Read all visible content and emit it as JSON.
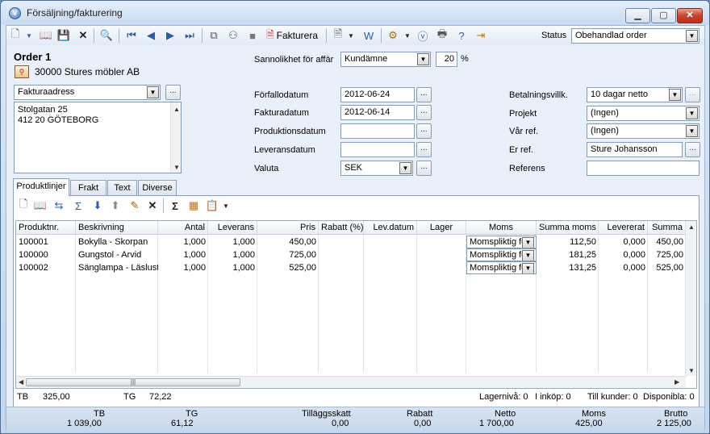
{
  "window": {
    "title": "Försäljning/fakturering",
    "minimize": "▁",
    "maximize": "▢",
    "close": "✕"
  },
  "toolbar": {
    "fakturera": "Fakturera",
    "status_label": "Status",
    "status_value": "Obehandlad order"
  },
  "order": {
    "title": "Order 1",
    "customer": "30000 Stures möbler AB"
  },
  "address": {
    "type": "Fakturaadress",
    "line1": "Stolgatan 25",
    "line2": "412 20 GÖTEBORG",
    "browse": "..."
  },
  "middle": {
    "sannolikhet_label": "Sannolikhet för affär",
    "sannolikhet_value": "Kundämne",
    "percent": "20",
    "percent_sign": "%",
    "forfallodatum_label": "Förfallodatum",
    "forfallodatum": "2012-06-24",
    "fakturadatum_label": "Fakturadatum",
    "fakturadatum": "2012-06-14",
    "produktionsdatum_label": "Produktionsdatum",
    "produktionsdatum": "",
    "leveransdatum_label": "Leveransdatum",
    "leveransdatum": "",
    "valuta_label": "Valuta",
    "valuta": "SEK"
  },
  "right": {
    "betalningsvillk_label": "Betalningsvillk.",
    "betalningsvillk": "10 dagar netto",
    "projekt_label": "Projekt",
    "projekt": "(Ingen)",
    "var_ref_label": "Vår ref.",
    "var_ref": "(Ingen)",
    "er_ref_label": "Er ref.",
    "er_ref": "Sture Johansson",
    "referens_label": "Referens",
    "referens": ""
  },
  "tabs": [
    "Produktlinjer",
    "Frakt",
    "Text",
    "Diverse"
  ],
  "grid": {
    "columns": [
      "Produktnr.",
      "Beskrivning",
      "Antal",
      "Leverans",
      "Pris",
      "Rabatt (%)",
      "Lev.datum",
      "Lager",
      "Moms",
      "Summa moms",
      "Levererat",
      "Summa"
    ],
    "rows": [
      [
        "100001",
        "Bokylla - Skorpan",
        "1,000",
        "1,000",
        "450,00",
        "",
        "",
        "",
        "Momspliktig fö",
        "112,50",
        "0,000",
        "450,00"
      ],
      [
        "100000",
        "Gungstol - Arvid",
        "1,000",
        "1,000",
        "725,00",
        "",
        "",
        "",
        "Momspliktig fö",
        "181,25",
        "0,000",
        "725,00"
      ],
      [
        "100002",
        "Sänglampa - Läslust",
        "1,000",
        "1,000",
        "525,00",
        "",
        "",
        "",
        "Momspliktig fö",
        "131,25",
        "0,000",
        "525,00"
      ]
    ]
  },
  "panel_footer": {
    "tb_label": "TB",
    "tb_value": "325,00",
    "tg_label": "TG",
    "tg_value": "72,22",
    "lagerniva": "Lagernivå: 0",
    "i_inkop": "I inköp: 0",
    "till_kunder": "Till kunder: 0",
    "disponibla": "Disponibla: 0"
  },
  "summary": {
    "tb_label": "TB",
    "tb": "1 039,00",
    "tg_label": "TG",
    "tg": "61,12",
    "tillaggsskatt_label": "Tilläggsskatt",
    "tillaggsskatt": "0,00",
    "rabatt_label": "Rabatt",
    "rabatt": "0,00",
    "netto_label": "Netto",
    "netto": "1 700,00",
    "moms_label": "Moms",
    "moms": "425,00",
    "brutto_label": "Brutto",
    "brutto": "2 125,00"
  }
}
